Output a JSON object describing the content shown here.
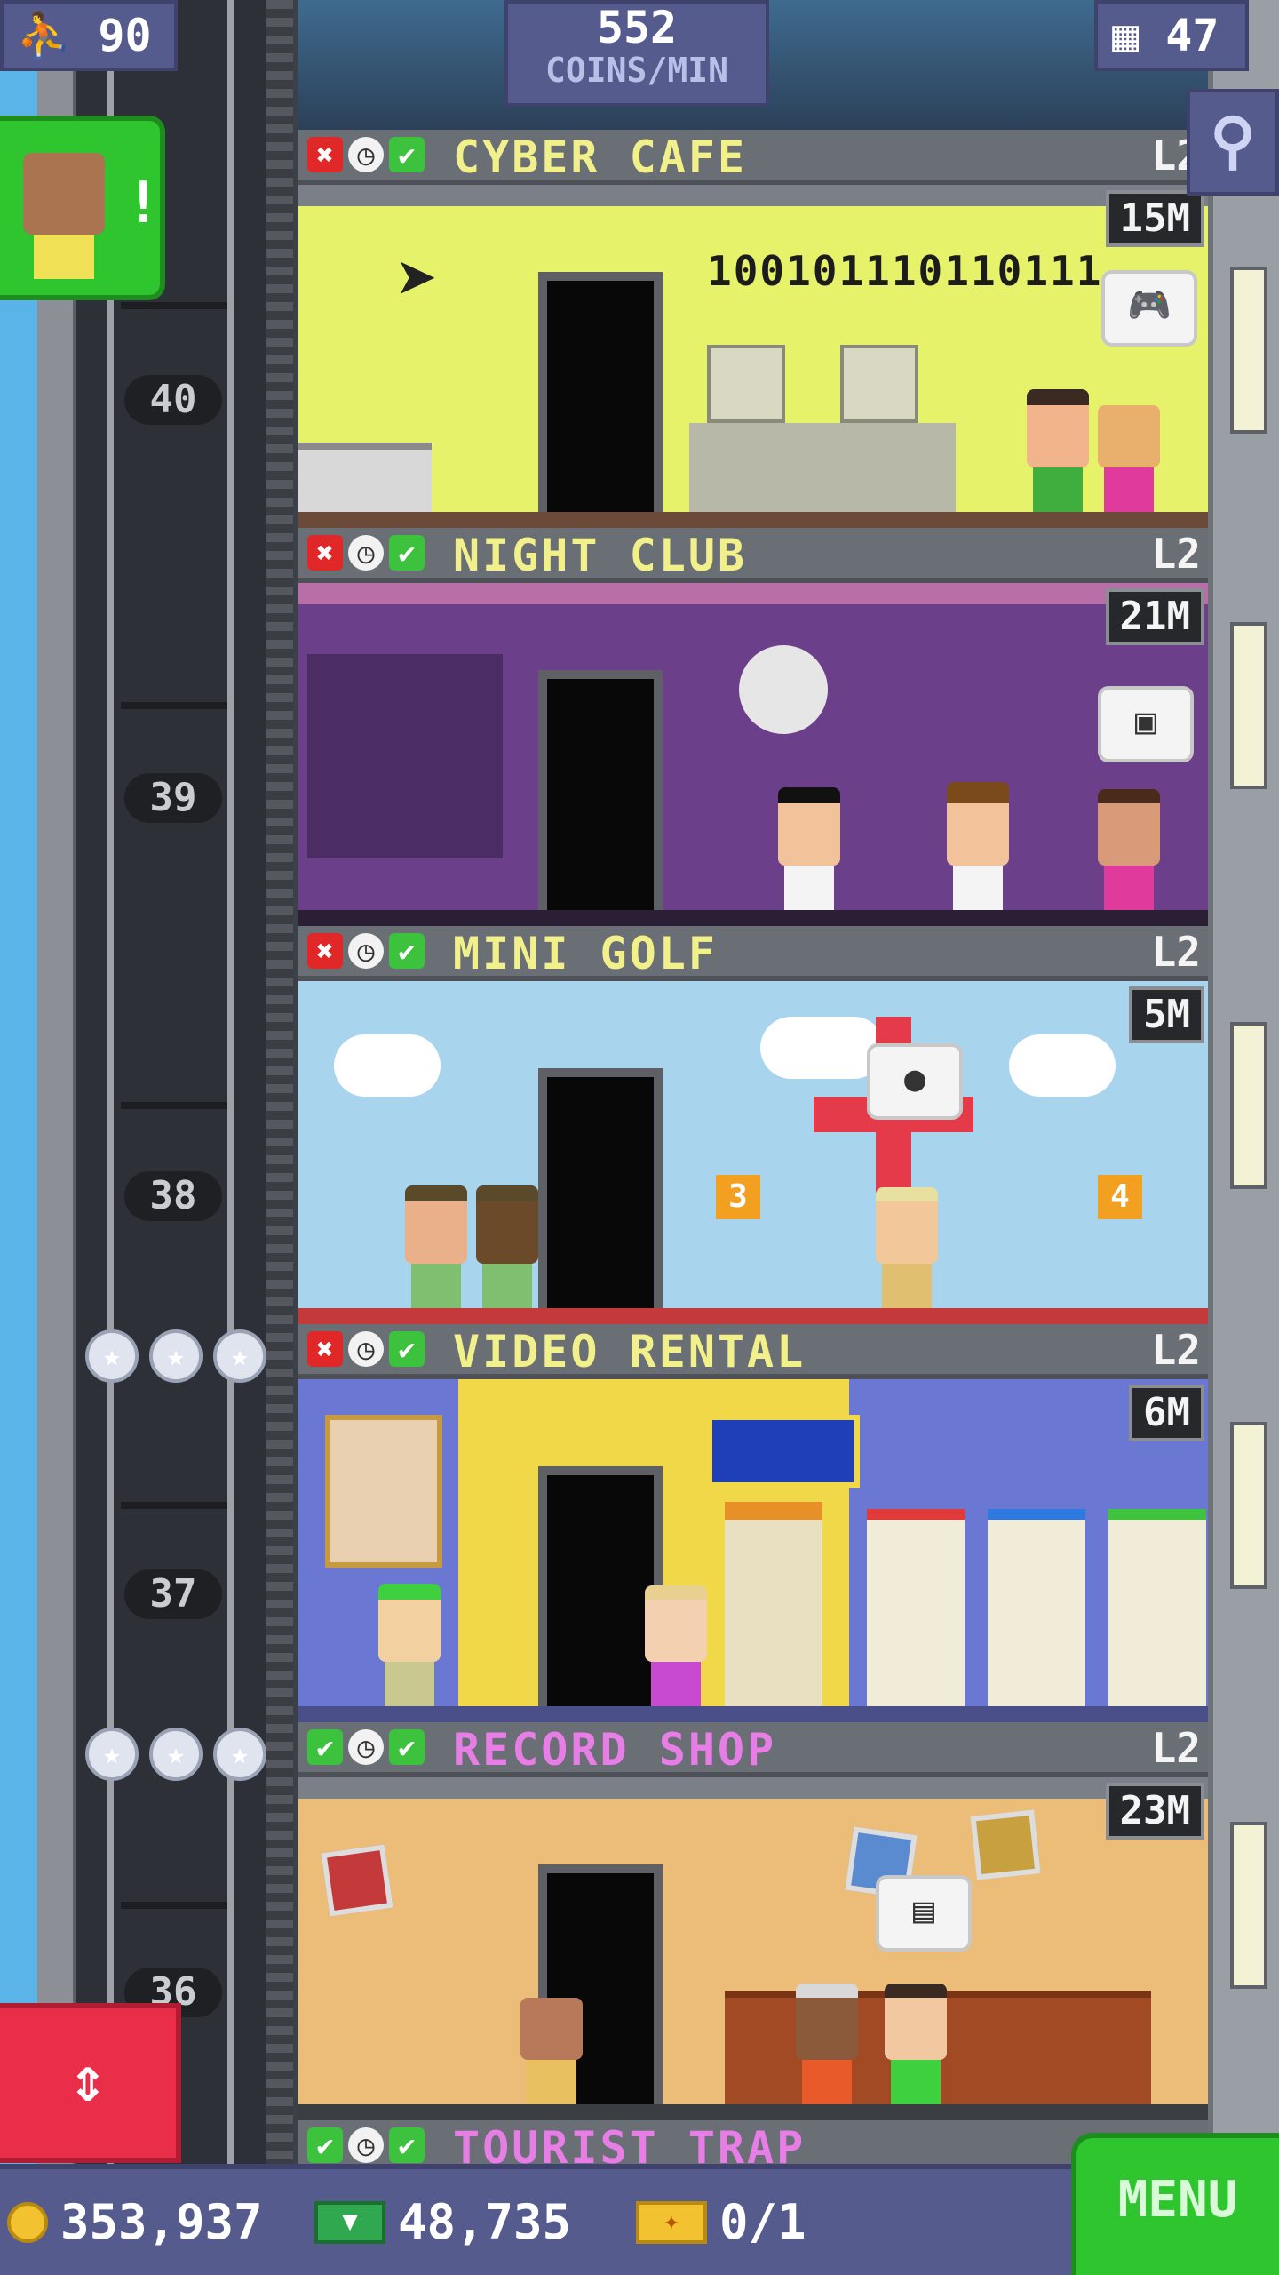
{
  "hud": {
    "population": "90",
    "population_icon": "person-icon",
    "coins_rate_value": "552",
    "coins_rate_label": "COINS/MIN",
    "floors_count": "47",
    "floors_icon": "building-icon"
  },
  "elevator": {
    "floor_numbers": [
      "40",
      "39",
      "38",
      "37",
      "36"
    ]
  },
  "floors": [
    {
      "name": "CYBER CAFE",
      "level": "L2",
      "stock": "15M",
      "status": [
        "x",
        "clock",
        "check"
      ],
      "name_color": "#f1f08a",
      "wall_color": "#e6f26a",
      "sign_text": "100101110110111"
    },
    {
      "name": "NIGHT CLUB",
      "level": "L2",
      "stock": "21M",
      "status": [
        "x",
        "clock",
        "check"
      ],
      "name_color": "#f1f08a",
      "wall_color": "#6b3f8a"
    },
    {
      "name": "MINI GOLF",
      "level": "L2",
      "stock": "5M",
      "status": [
        "x",
        "clock",
        "check"
      ],
      "name_color": "#f1f08a",
      "wall_color": "#a9d4ee",
      "hole_labels": [
        "3",
        "4"
      ]
    },
    {
      "name": "VIDEO RENTAL",
      "level": "L2",
      "stock": "6M",
      "status": [
        "x",
        "clock",
        "check"
      ],
      "name_color": "#f1f08a",
      "wall_color": "#f0d848"
    },
    {
      "name": "RECORD SHOP",
      "level": "L2",
      "stock": "23M",
      "status": [
        "check",
        "clock",
        "check"
      ],
      "name_color": "#e77ee6",
      "wall_color": "#ecbd79"
    }
  ],
  "partial_floor": {
    "name": "TOURIST TRAP",
    "status": [
      "check",
      "clock",
      "check"
    ]
  },
  "bottom": {
    "coins": "353,937",
    "bux": "48,735",
    "tickets": "0/1",
    "menu_label": "MENU"
  },
  "colors": {
    "accent_green": "#2ec52e",
    "hud_blue": "#565b8e",
    "elevator_red": "#ea2e4a"
  }
}
